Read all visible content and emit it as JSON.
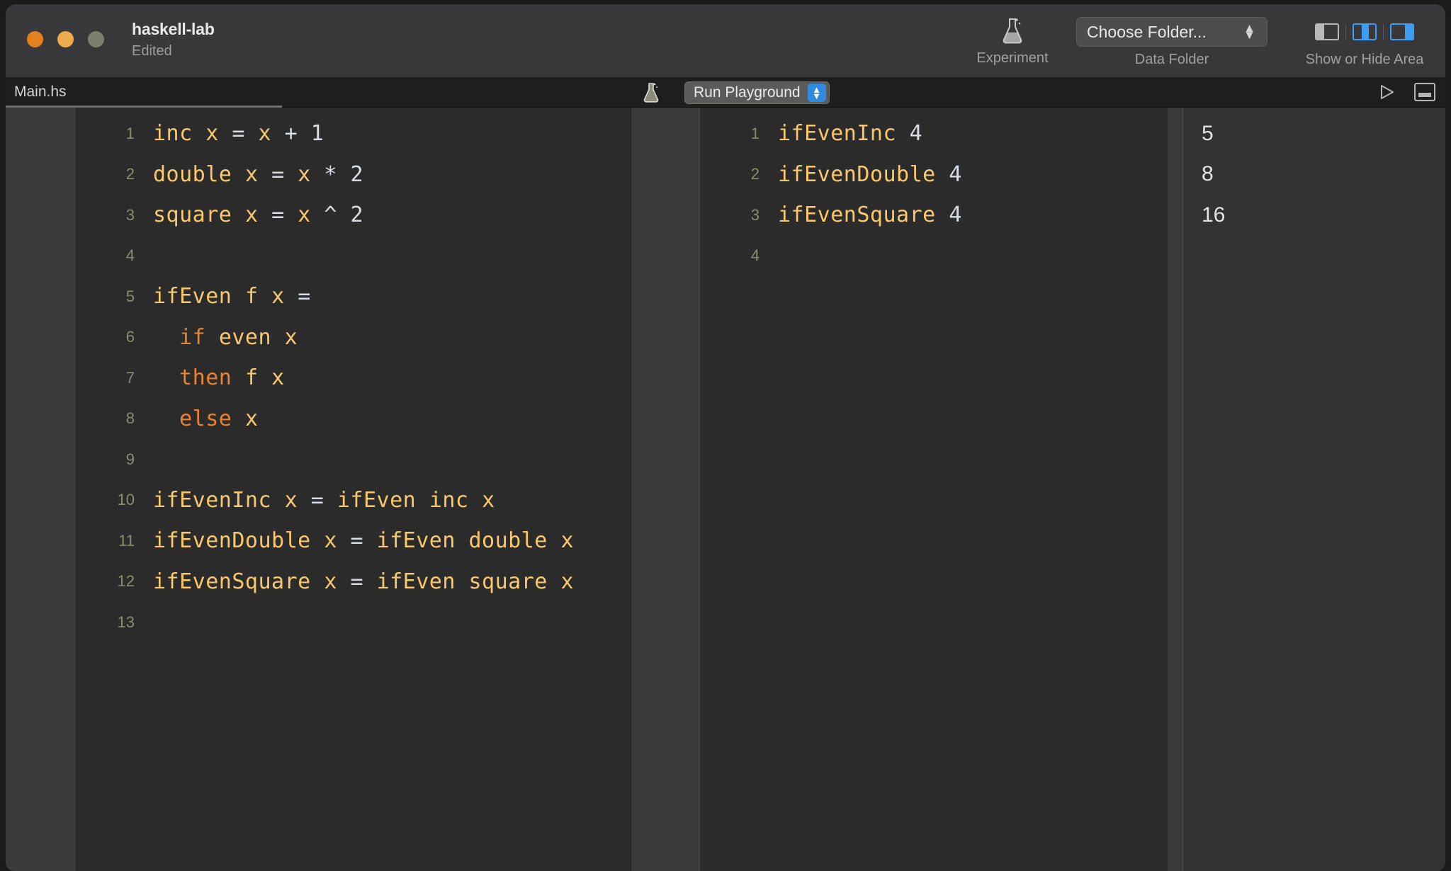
{
  "window": {
    "title": "haskell-lab",
    "subtitle": "Edited",
    "traffic_lights": [
      {
        "name": "close",
        "color": "#e58020"
      },
      {
        "name": "minimize",
        "color": "#efaa4e"
      },
      {
        "name": "zoom",
        "color": "#7d7e6b"
      }
    ]
  },
  "toolbar": {
    "experiment": {
      "icon": "flask-icon",
      "caption": "Experiment"
    },
    "data_folder": {
      "button_label": "Choose Folder...",
      "caption": "Data Folder"
    },
    "show_hide_area": {
      "caption": "Show or Hide Area",
      "buttons": [
        {
          "name": "left-panel-toggle",
          "icon": "panel-left-icon",
          "active": false
        },
        {
          "name": "middle-panel-toggle",
          "icon": "panel-middle-icon",
          "active": true
        },
        {
          "name": "right-panel-toggle",
          "icon": "panel-right-icon",
          "active": true
        }
      ]
    },
    "accent_color": "#3d9cf4"
  },
  "tabbar": {
    "tab_label": "Main.hs",
    "flask_icon": "flask-icon",
    "run_button_label": "Run Playground",
    "run_stepper_color": "#2f8ae0",
    "right_icons": [
      {
        "name": "play-icon"
      },
      {
        "name": "console-panel-icon"
      }
    ]
  },
  "editor": {
    "filename": "Main.hs",
    "lines": [
      {
        "n": "1",
        "tokens": [
          {
            "t": "inc",
            "c": "id"
          },
          {
            "t": " ",
            "c": "op"
          },
          {
            "t": "x",
            "c": "id"
          },
          {
            "t": " ",
            "c": "op"
          },
          {
            "t": "=",
            "c": "op"
          },
          {
            "t": " ",
            "c": "op"
          },
          {
            "t": "x",
            "c": "id"
          },
          {
            "t": " ",
            "c": "op"
          },
          {
            "t": "+",
            "c": "op"
          },
          {
            "t": " ",
            "c": "op"
          },
          {
            "t": "1",
            "c": "num"
          }
        ]
      },
      {
        "n": "2",
        "tokens": [
          {
            "t": "double",
            "c": "id"
          },
          {
            "t": " ",
            "c": "op"
          },
          {
            "t": "x",
            "c": "id"
          },
          {
            "t": " ",
            "c": "op"
          },
          {
            "t": "=",
            "c": "op"
          },
          {
            "t": " ",
            "c": "op"
          },
          {
            "t": "x",
            "c": "id"
          },
          {
            "t": " ",
            "c": "op"
          },
          {
            "t": "*",
            "c": "op"
          },
          {
            "t": " ",
            "c": "op"
          },
          {
            "t": "2",
            "c": "num"
          }
        ]
      },
      {
        "n": "3",
        "tokens": [
          {
            "t": "square",
            "c": "id"
          },
          {
            "t": " ",
            "c": "op"
          },
          {
            "t": "x",
            "c": "id"
          },
          {
            "t": " ",
            "c": "op"
          },
          {
            "t": "=",
            "c": "op"
          },
          {
            "t": " ",
            "c": "op"
          },
          {
            "t": "x",
            "c": "id"
          },
          {
            "t": " ",
            "c": "op"
          },
          {
            "t": "^",
            "c": "op"
          },
          {
            "t": " ",
            "c": "op"
          },
          {
            "t": "2",
            "c": "num"
          }
        ]
      },
      {
        "n": "4",
        "tokens": []
      },
      {
        "n": "5",
        "tokens": [
          {
            "t": "ifEven",
            "c": "id"
          },
          {
            "t": " ",
            "c": "op"
          },
          {
            "t": "f",
            "c": "id"
          },
          {
            "t": " ",
            "c": "op"
          },
          {
            "t": "x",
            "c": "id"
          },
          {
            "t": " ",
            "c": "op"
          },
          {
            "t": "=",
            "c": "op"
          }
        ]
      },
      {
        "n": "6",
        "tokens": [
          {
            "t": "  ",
            "c": "op"
          },
          {
            "t": "if",
            "c": "kw"
          },
          {
            "t": " ",
            "c": "op"
          },
          {
            "t": "even",
            "c": "id"
          },
          {
            "t": " ",
            "c": "op"
          },
          {
            "t": "x",
            "c": "id"
          }
        ]
      },
      {
        "n": "7",
        "tokens": [
          {
            "t": "  ",
            "c": "op"
          },
          {
            "t": "then",
            "c": "kw"
          },
          {
            "t": " ",
            "c": "op"
          },
          {
            "t": "f",
            "c": "id"
          },
          {
            "t": " ",
            "c": "op"
          },
          {
            "t": "x",
            "c": "id"
          }
        ]
      },
      {
        "n": "8",
        "tokens": [
          {
            "t": "  ",
            "c": "op"
          },
          {
            "t": "else",
            "c": "kw"
          },
          {
            "t": " ",
            "c": "op"
          },
          {
            "t": "x",
            "c": "id"
          }
        ]
      },
      {
        "n": "9",
        "tokens": []
      },
      {
        "n": "10",
        "tokens": [
          {
            "t": "ifEvenInc",
            "c": "id"
          },
          {
            "t": " ",
            "c": "op"
          },
          {
            "t": "x",
            "c": "id"
          },
          {
            "t": " ",
            "c": "op"
          },
          {
            "t": "=",
            "c": "op"
          },
          {
            "t": " ",
            "c": "op"
          },
          {
            "t": "ifEven",
            "c": "id"
          },
          {
            "t": " ",
            "c": "op"
          },
          {
            "t": "inc",
            "c": "id"
          },
          {
            "t": " ",
            "c": "op"
          },
          {
            "t": "x",
            "c": "id"
          }
        ]
      },
      {
        "n": "11",
        "tokens": [
          {
            "t": "ifEvenDouble",
            "c": "id"
          },
          {
            "t": " ",
            "c": "op"
          },
          {
            "t": "x",
            "c": "id"
          },
          {
            "t": " ",
            "c": "op"
          },
          {
            "t": "=",
            "c": "op"
          },
          {
            "t": " ",
            "c": "op"
          },
          {
            "t": "ifEven",
            "c": "id"
          },
          {
            "t": " ",
            "c": "op"
          },
          {
            "t": "double",
            "c": "id"
          },
          {
            "t": " ",
            "c": "op"
          },
          {
            "t": "x",
            "c": "id"
          }
        ]
      },
      {
        "n": "12",
        "tokens": [
          {
            "t": "ifEvenSquare",
            "c": "id"
          },
          {
            "t": " ",
            "c": "op"
          },
          {
            "t": "x",
            "c": "id"
          },
          {
            "t": " ",
            "c": "op"
          },
          {
            "t": "=",
            "c": "op"
          },
          {
            "t": " ",
            "c": "op"
          },
          {
            "t": "ifEven",
            "c": "id"
          },
          {
            "t": " ",
            "c": "op"
          },
          {
            "t": "square",
            "c": "id"
          },
          {
            "t": " ",
            "c": "op"
          },
          {
            "t": "x",
            "c": "id"
          }
        ]
      },
      {
        "n": "13",
        "tokens": []
      }
    ]
  },
  "playground": {
    "lines": [
      {
        "n": "1",
        "tokens": [
          {
            "t": "ifEvenInc",
            "c": "id"
          },
          {
            "t": " ",
            "c": "op"
          },
          {
            "t": "4",
            "c": "num"
          }
        ]
      },
      {
        "n": "2",
        "tokens": [
          {
            "t": "ifEvenDouble",
            "c": "id"
          },
          {
            "t": " ",
            "c": "op"
          },
          {
            "t": "4",
            "c": "num"
          }
        ]
      },
      {
        "n": "3",
        "tokens": [
          {
            "t": "ifEvenSquare",
            "c": "id"
          },
          {
            "t": " ",
            "c": "op"
          },
          {
            "t": "4",
            "c": "num"
          }
        ]
      },
      {
        "n": "4",
        "tokens": []
      }
    ]
  },
  "results": {
    "values": [
      "5",
      "8",
      "16",
      ""
    ]
  },
  "theme": {
    "editor_background": "#2b2b2b",
    "gutter_background": "#3a3a3a",
    "titlebar_background": "#38383a",
    "tabbar_background": "#1e1e1f",
    "results_background": "#323233",
    "identifier_color": "#f9c86d",
    "keyword_color": "#e8822f",
    "operator_color": "#d8dde4",
    "line_number_color": "#8c8c70"
  }
}
